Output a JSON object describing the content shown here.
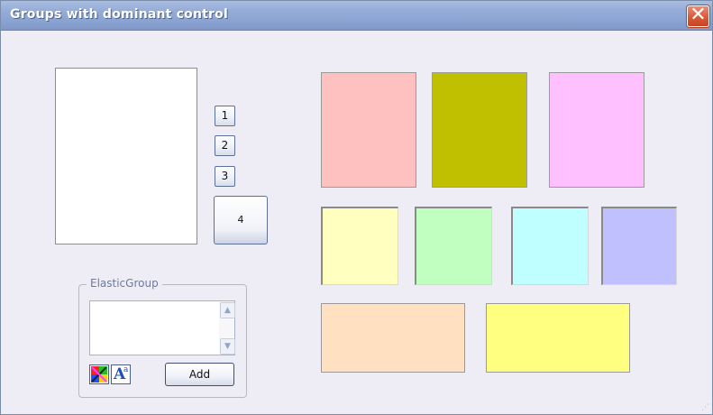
{
  "window": {
    "title": "Groups with dominant control",
    "close_symbol": "✕"
  },
  "buttons": {
    "b1": "1",
    "b2": "2",
    "b3": "3",
    "b4": "4"
  },
  "elastic_group": {
    "label": "ElasticGroup",
    "text_value": "",
    "scroll_up": "▲",
    "scroll_down": "▼",
    "color_icon": "color-palette-icon",
    "font_icon": "font-icon",
    "font_icon_text": "A",
    "font_icon_sup": "a",
    "add_label": "Add"
  },
  "swatches": {
    "pink": "#ffc0c0",
    "olive": "#c0c000",
    "lavender": "#ffc0ff",
    "light_yellow": "#ffffc0",
    "light_green": "#c0ffc0",
    "light_cyan": "#c0ffff",
    "light_blue": "#c0c0ff",
    "peach": "#ffe0c0",
    "yellow": "#ffff80"
  },
  "colors": {
    "accent_titlebar": "#8aa3d2",
    "window_bg": "#eeedf5",
    "close_red": "#d95a38"
  }
}
